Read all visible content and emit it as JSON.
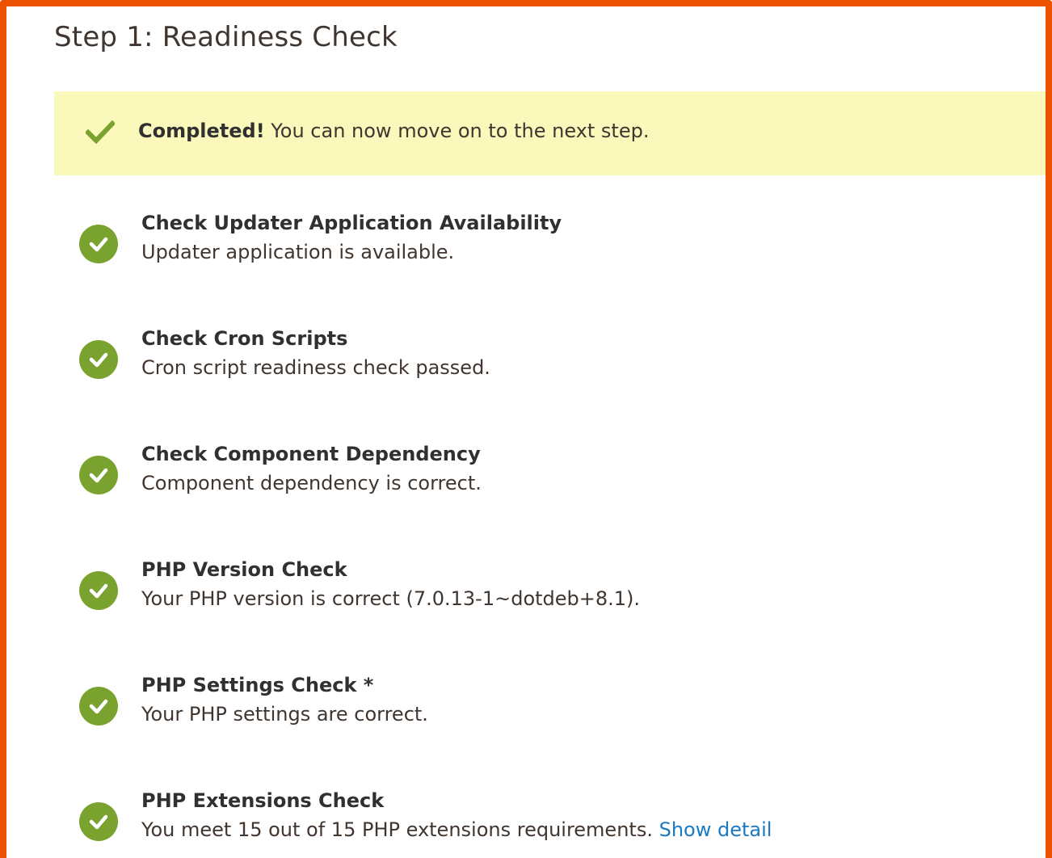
{
  "page": {
    "title": "Step 1: Readiness Check"
  },
  "banner": {
    "icon": "checkmark-icon",
    "strong": "Completed!",
    "text": " You can now move on to the next step."
  },
  "checks": [
    {
      "icon": "check-circle-icon",
      "title": "Check Updater Application Availability",
      "desc": "Updater application is available."
    },
    {
      "icon": "check-circle-icon",
      "title": "Check Cron Scripts",
      "desc": "Cron script readiness check passed."
    },
    {
      "icon": "check-circle-icon",
      "title": "Check Component Dependency",
      "desc": "Component dependency is correct."
    },
    {
      "icon": "check-circle-icon",
      "title": "PHP Version Check",
      "desc": "Your PHP version is correct (7.0.13-1~dotdeb+8.1)."
    },
    {
      "icon": "check-circle-icon",
      "title": "PHP Settings Check *",
      "desc": "Your PHP settings are correct."
    },
    {
      "icon": "check-circle-icon",
      "title": "PHP Extensions Check",
      "desc": "You meet 15 out of 15 PHP extensions requirements. ",
      "link": "Show detail"
    }
  ],
  "colors": {
    "frame": "#eb5202",
    "banner_bg": "#fbf8bc",
    "success": "#79a22e",
    "link": "#1979c3"
  }
}
